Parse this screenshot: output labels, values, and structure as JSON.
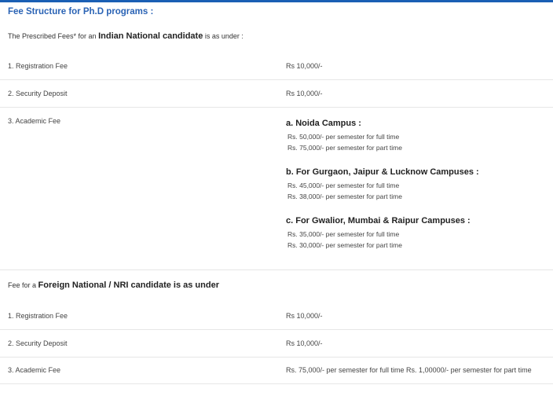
{
  "title": "Fee Structure for Ph.D programs :",
  "indian": {
    "intro_pre": "The Prescribed Fees* for an",
    "intro_bold": "Indian National candidate",
    "intro_post": "is as under :",
    "rows": [
      {
        "label": "1. Registration Fee",
        "value": "Rs 10,000/-"
      },
      {
        "label": "2. Security Deposit",
        "value": "Rs 10,000/-"
      },
      {
        "label": "3. Academic Fee"
      }
    ],
    "campuses": [
      {
        "name": "a.  Noida Campus :",
        "full": "Rs. 50,000/- per semester for full time",
        "part": "Rs. 75,000/- per semester for part time"
      },
      {
        "name": "b.  For Gurgaon, Jaipur & Lucknow Campuses :",
        "full": "Rs. 45,000/- per semester for full time",
        "part": "Rs. 38,000/- per semester for part time"
      },
      {
        "name": "c.  For Gwalior, Mumbai & Raipur Campuses :",
        "full": "Rs. 35,000/- per semester for full time",
        "part": "Rs. 30,000/- per semester for part time"
      }
    ]
  },
  "foreign": {
    "intro_pre": "Fee for a",
    "intro_bold": "Foreign National / NRI candidate is as under",
    "rows": [
      {
        "label": "1. Registration Fee",
        "value": "Rs 10,000/-"
      },
      {
        "label": "2. Security Deposit",
        "value": "Rs 10,000/-"
      },
      {
        "label": "3. Academic Fee",
        "value": "Rs. 75,000/- per semester for full time Rs. 1,00000/- per semester for part time"
      }
    ]
  },
  "colors": {
    "accent": "#2a63b5",
    "topbar": "#1a5fb4",
    "divider": "#e6e6e6"
  }
}
